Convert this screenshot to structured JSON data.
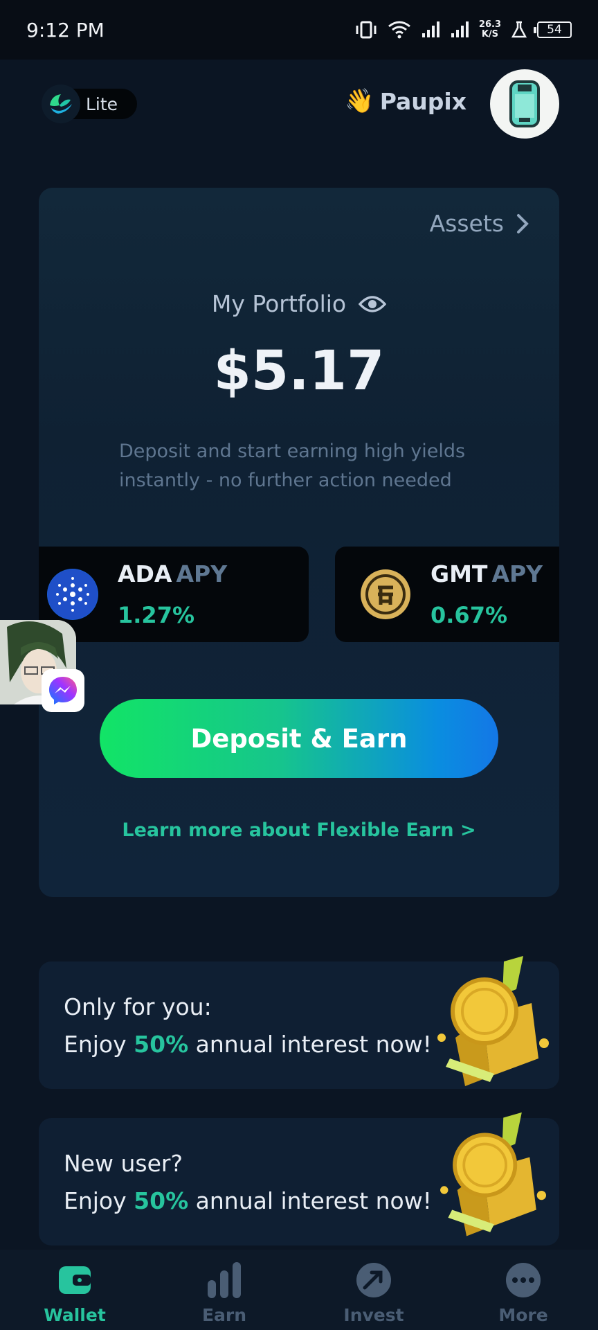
{
  "status_bar": {
    "time": "9:12 PM",
    "net_speed_value": "26.3",
    "net_speed_unit": "K/S",
    "battery": "54"
  },
  "header": {
    "mode_label": "Lite",
    "greeting_emoji": "👋",
    "username": "Paupix"
  },
  "portfolio": {
    "assets_label": "Assets",
    "title": "My Portfolio",
    "value": "$5.17",
    "description": "Deposit and start earning high yields instantly - no further action needed",
    "apy_cards": [
      {
        "symbol": "ADA",
        "tag": "APY",
        "rate": "1.27%"
      },
      {
        "symbol": "GMT",
        "tag": "APY",
        "rate": "0.67%"
      }
    ],
    "deposit_button": "Deposit & Earn",
    "learn_more": "Learn more about Flexible Earn >"
  },
  "promos": [
    {
      "line1": "Only for you:",
      "line2_prefix": "Enjoy ",
      "line2_highlight": "50%",
      "line2_suffix": " annual interest now!"
    },
    {
      "line1": "New user?",
      "line2_prefix": "Enjoy ",
      "line2_highlight": "50%",
      "line2_suffix": " annual interest now!"
    }
  ],
  "bottom_nav": [
    {
      "label": "Wallet",
      "icon": "wallet-icon",
      "active": true
    },
    {
      "label": "Earn",
      "icon": "bar-chart-icon",
      "active": false
    },
    {
      "label": "Invest",
      "icon": "trend-arrow-icon",
      "active": false
    },
    {
      "label": "More",
      "icon": "more-dots-icon",
      "active": false
    }
  ],
  "colors": {
    "background": "#0b1523",
    "accent_green": "#27c49e",
    "card": "#0f1f33",
    "nav_inactive": "#4a5d74"
  }
}
